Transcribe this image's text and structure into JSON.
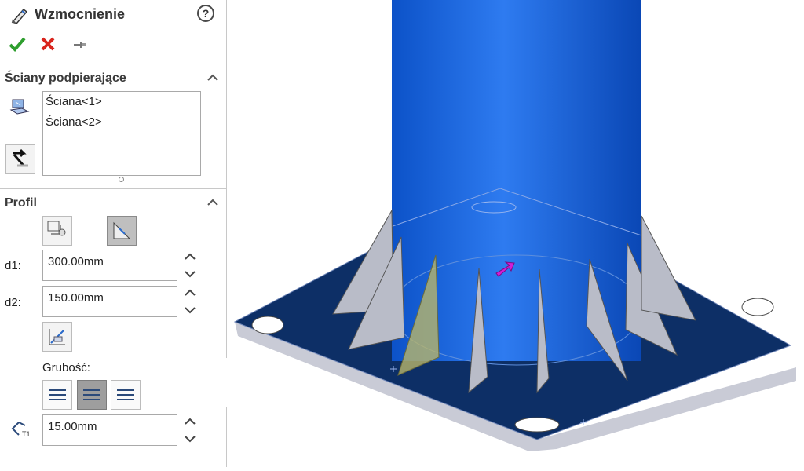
{
  "panel": {
    "title": "Wzmocnienie",
    "help_icon": "?",
    "ok_icon": "check-icon",
    "cancel_icon": "close-icon",
    "pin_icon": "pushpin-icon"
  },
  "sections": {
    "faces": {
      "heading": "Ściany podpierające",
      "items": [
        "Ściana<1>",
        "Ściana<2>"
      ]
    },
    "profile": {
      "heading": "Profil",
      "d1_label": "d1:",
      "d1_value": "300.00mm",
      "d2_label": "d2:",
      "d2_value": "150.00mm",
      "thickness_label": "Grubość:",
      "thickness_value": "15.00mm"
    }
  },
  "colors": {
    "ok": "#2e9e2e",
    "cancel": "#d9251d",
    "model_blue": "#1565d8",
    "plate_navy": "#0d2f66",
    "rib_gray": "#b9bcc8",
    "preview_rib": "#b8b56a",
    "arrow_magenta": "#d21ed6"
  }
}
